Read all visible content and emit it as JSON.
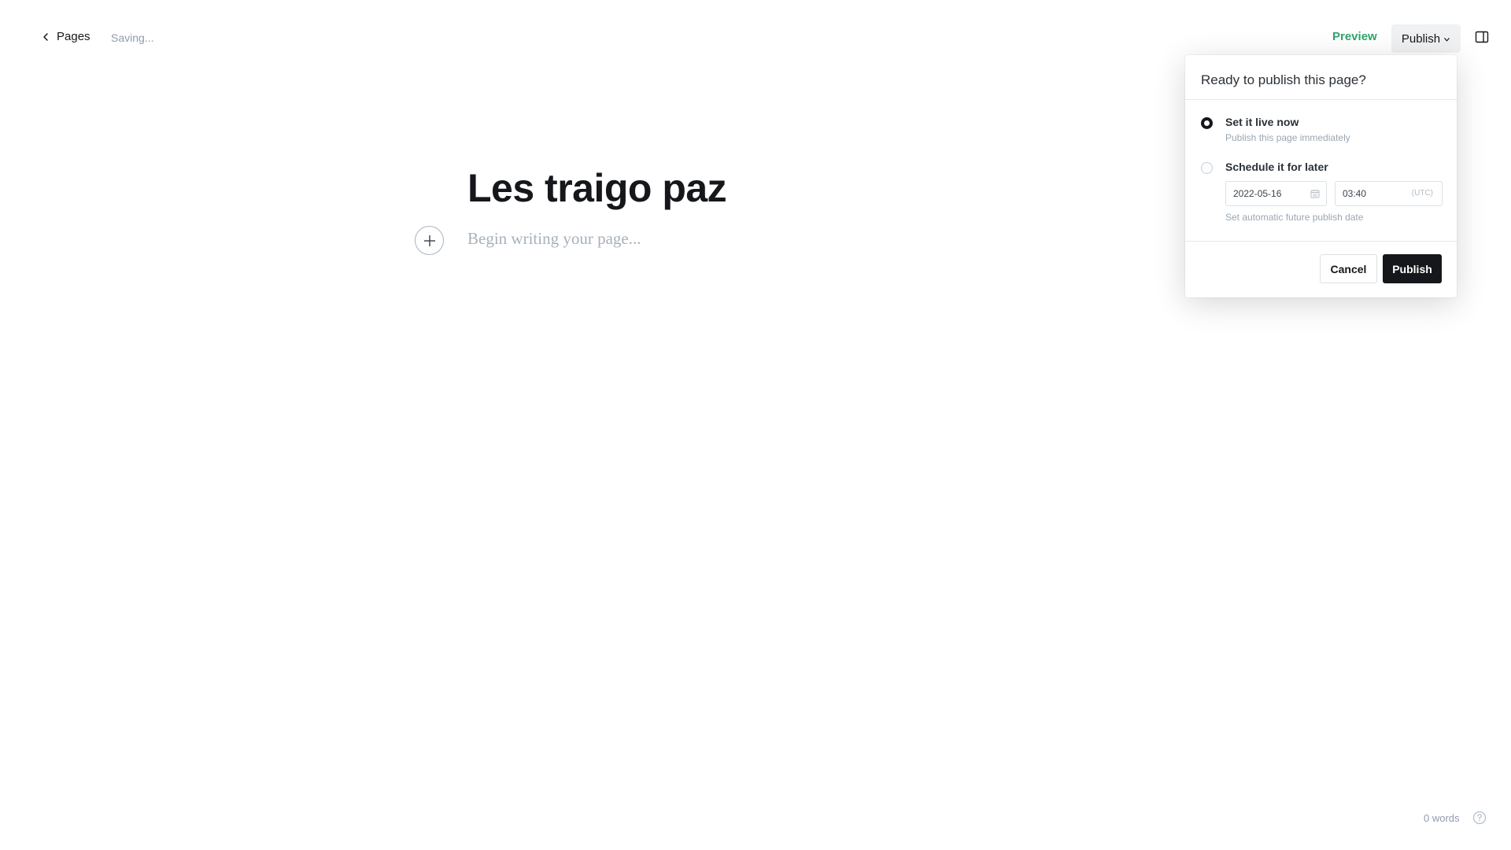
{
  "header": {
    "back_label": "Pages",
    "status": "Saving...",
    "preview_label": "Preview",
    "publish_label": "Publish"
  },
  "editor": {
    "title": "Les traigo paz",
    "body_placeholder": "Begin writing your page..."
  },
  "publish_popover": {
    "heading": "Ready to publish this page?",
    "options": [
      {
        "label": "Set it live now",
        "description": "Publish this page immediately",
        "selected": true
      },
      {
        "label": "Schedule it for later",
        "description": "Set automatic future publish date",
        "selected": false
      }
    ],
    "date_value": "2022-05-16",
    "time_value": "03:40",
    "timezone": "(UTC)",
    "cancel_label": "Cancel",
    "confirm_label": "Publish"
  },
  "footer": {
    "word_count": "0 words"
  },
  "icons": {
    "back": "chevron-left-icon",
    "publish_menu": "chevron-down-icon",
    "sidebar": "sidebar-toggle-icon",
    "add_card": "plus-icon",
    "calendar": "calendar-icon",
    "help": "question-circle-icon"
  },
  "colors": {
    "accent_green": "#30a46c",
    "primary_dark": "#15171a",
    "muted": "#8e9cac"
  }
}
